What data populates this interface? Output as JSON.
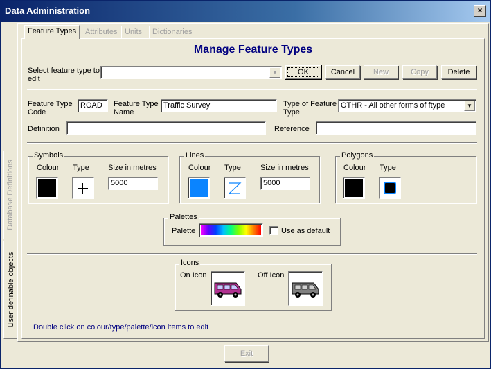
{
  "window": {
    "title": "Data Administration",
    "close_label": "×"
  },
  "side_tabs": {
    "database_definitions": "Database Definitions",
    "user_definable": "User definable objects"
  },
  "tabs": [
    "Feature Types",
    "Attributes",
    "Units",
    "Dictionaries"
  ],
  "heading": "Manage Feature Types",
  "select": {
    "label": "Select feature type to edit",
    "value": ""
  },
  "buttons": {
    "ok": "OK",
    "cancel": "Cancel",
    "new": "New",
    "copy": "Copy",
    "delete": "Delete",
    "exit": "Exit"
  },
  "form": {
    "code_label": "Feature Type Code",
    "code_value": "ROAD",
    "name_label": "Feature Type Name",
    "name_value": "Traffic Survey",
    "type_label": "Type of Feature Type",
    "type_value": "OTHR - All other forms of ftype",
    "definition_label": "Definition",
    "definition_value": "",
    "reference_label": "Reference",
    "reference_value": ""
  },
  "symbols": {
    "title": "Symbols",
    "colour_label": "Colour",
    "type_label": "Type",
    "size_label": "Size in metres",
    "size_value": "5000",
    "colour": "#000000",
    "type_icon": "plus-icon"
  },
  "lines": {
    "title": "Lines",
    "colour_label": "Colour",
    "type_label": "Type",
    "size_label": "Size in metres",
    "size_value": "5000",
    "colour": "#0a84ff",
    "type_icon": "z-line-icon"
  },
  "polygons": {
    "title": "Polygons",
    "colour_label": "Colour",
    "type_label": "Type",
    "colour": "#000000",
    "type_icon": "filled-square-icon"
  },
  "palettes": {
    "title": "Palettes",
    "palette_label": "Palette",
    "use_default_label": "Use as default",
    "use_default_checked": false
  },
  "icons": {
    "title": "Icons",
    "on_label": "On Icon",
    "off_label": "Off Icon",
    "on_icon": "van-color-icon",
    "off_icon": "van-gray-icon"
  },
  "hint": "Double click on colour/type/palette/icon items to edit"
}
